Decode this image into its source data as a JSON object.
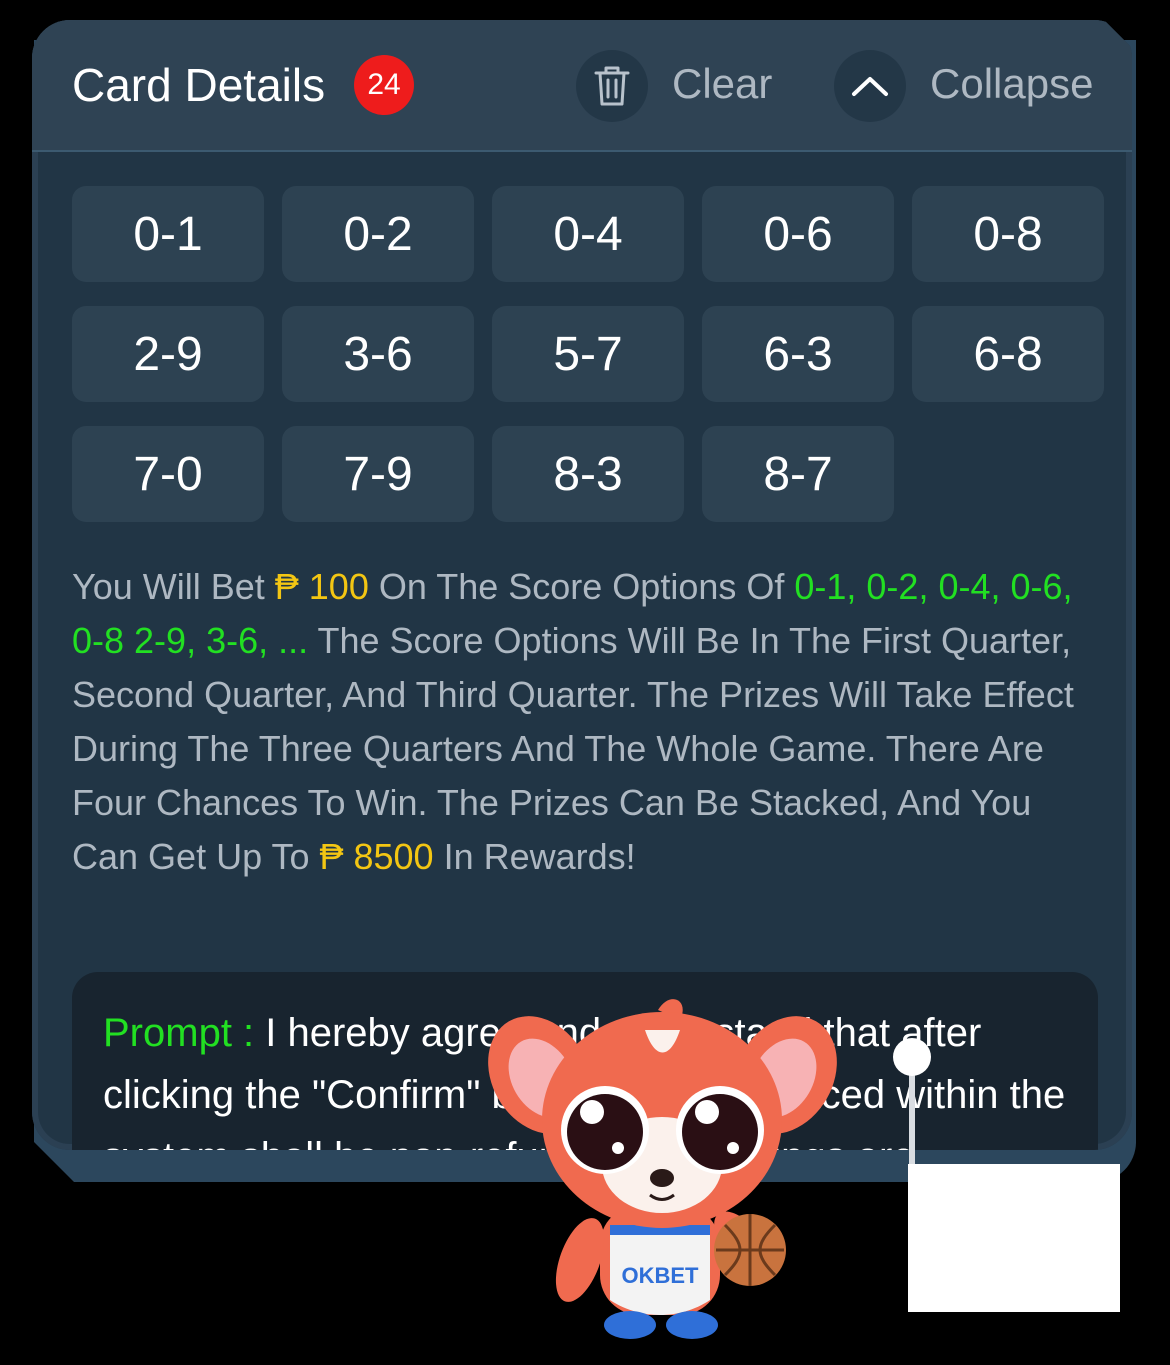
{
  "header": {
    "title": "Card Details",
    "badge_count": "24",
    "clear_label": "Clear",
    "collapse_label": "Collapse"
  },
  "score_options": [
    "0-1",
    "0-2",
    "0-4",
    "0-6",
    "0-8",
    "2-9",
    "3-6",
    "5-7",
    "6-3",
    "6-8",
    "7-0",
    "7-9",
    "8-3",
    "8-7"
  ],
  "description": {
    "part1": "You Will Bet ",
    "bet_amount": "₱ 100",
    "part2": " On The Score Options Of ",
    "options_preview": "0-1, 0-2, 0-4, 0-6, 0-8 2-9, 3-6, ...",
    "part3": " The Score Options Will Be In The First Quarter, Second Quarter, And Third Quarter. The Prizes Will Take Effect During The Three Quarters And The Whole Game. There Are Four Chances To Win. The Prizes Can Be Stacked, And You Can Get Up To ",
    "max_reward": "₱ 8500",
    "part4": " In Rewards!"
  },
  "prompt": {
    "label": "Prompt : ",
    "text": "I hereby agree and understand that after clicking the \"Confirm\" button, any bet placed within the system shall be non-refundable. Winnings are"
  },
  "mascot": {
    "jersey_logo": "OKBET"
  },
  "colors": {
    "accent_green": "#22e022",
    "accent_yellow": "#f3c613",
    "badge_red": "#ee1c1c"
  }
}
